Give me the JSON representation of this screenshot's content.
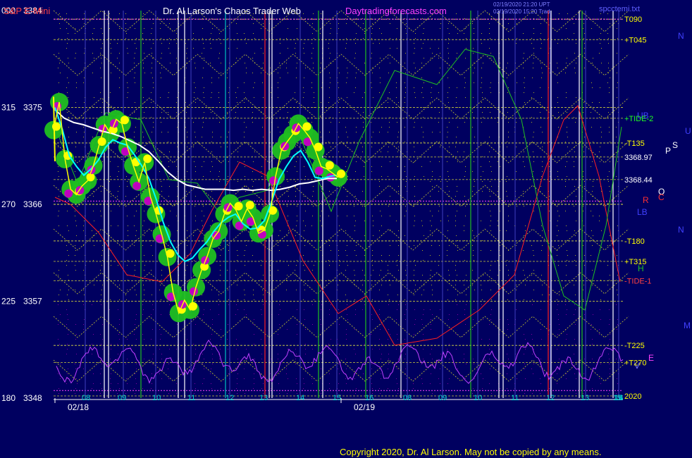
{
  "header": {
    "symbol": "S&P E-Mini",
    "title": "Dr. Al Larson's Chaos Trader Web",
    "site": "Daytradingforecasts.com",
    "stamp1": "02/19/2020 21:20 UPT",
    "stamp2": "02/19/2020 15:20 Trad",
    "file": "spcctemi.txt"
  },
  "copyright": "Copyright 2020, Dr. Al Larson. May not be copied by any means.",
  "colors": {
    "background": "#000060",
    "price": "#ffff00",
    "fast_avg": "#00ffff",
    "slow_avg": "#ffffff",
    "tide1": "#ff2020",
    "tide2": "#20c020",
    "oscillator": "#c040ff",
    "glow": "#20c020",
    "dots": "#ffff00",
    "dots_low": "#c000c0",
    "grid": "#ffff00"
  },
  "chart_data": {
    "type": "line",
    "title": "S&P E-Mini",
    "ylim": [
      3348,
      3384
    ],
    "y_ticks": [
      {
        "left": "000",
        "price": "3384"
      },
      {
        "left": "315",
        "price": "3375"
      },
      {
        "left": "270",
        "price": "3366"
      },
      {
        "left": "225",
        "price": "3357"
      },
      {
        "left": "180",
        "price": "3348"
      }
    ],
    "x_ticks": [
      "08",
      "09",
      "10",
      "11",
      "12",
      "13",
      "14",
      "15",
      "16",
      "08",
      "09",
      "10",
      "11",
      "12",
      "13",
      "14",
      "15",
      "16"
    ],
    "date_labels": [
      "02/18",
      "02/19"
    ],
    "legend_right": [
      {
        "label": "T090",
        "color": "#ffff00",
        "price": 3383.2
      },
      {
        "label": "+T045",
        "color": "#ffff00",
        "price": 3381.3
      },
      {
        "label": "+TIDE-2",
        "color": "#20ff20",
        "price": 3374.0
      },
      {
        "label": "-T135",
        "color": "#ffff00",
        "price": 3371.7
      },
      {
        "label": "3368.97",
        "color": "#ffffff",
        "price": 3370.4
      },
      {
        "label": "3368.44",
        "color": "#ffffff",
        "price": 3368.3
      },
      {
        "label": "-T180",
        "color": "#ffff00",
        "price": 3362.6
      },
      {
        "label": "+T315",
        "color": "#ffff00",
        "price": 3360.7
      },
      {
        "label": "-TIDE-1",
        "color": "#ff4040",
        "price": 3358.9
      },
      {
        "label": "-T225",
        "color": "#ffff00",
        "price": 3352.9
      },
      {
        "label": "+T270",
        "color": "#ffff00",
        "price": 3351.3
      },
      {
        "label": "2020",
        "color": "#ffff00",
        "price": 3348.2
      }
    ],
    "markers": [
      "N",
      "U",
      "P",
      "S",
      "O",
      "R",
      "C",
      "N",
      "H",
      "M",
      "UB",
      "LB",
      "E",
      "V"
    ],
    "series": [
      {
        "name": "Price",
        "values": [
          3372.9,
          3375.5,
          3370.2,
          3367.4,
          3366.9,
          3367.7,
          3368.2,
          3369.6,
          3371.5,
          3373.4,
          3372.6,
          3373.9,
          3373.5,
          3371.3,
          3369.6,
          3368.1,
          3369.9,
          3366.7,
          3365.1,
          3363.2,
          3361.1,
          3357.8,
          3355.9,
          3357.1,
          3356.2,
          3358.3,
          3359.9,
          3361.2,
          3362.8,
          3363.5,
          3365.1,
          3366.1,
          3365.5,
          3364.4,
          3365.6,
          3364.8,
          3363.3,
          3363.6,
          3365.1,
          3368.6,
          3371.0,
          3371.8,
          3372.5,
          3373.5,
          3372.9,
          3372.2,
          3371.0,
          3369.5,
          3369.3,
          3368.9,
          3368.5
        ]
      },
      {
        "name": "Fast Average",
        "values": [
          3375.0,
          3373.0,
          3370.5,
          3369.5,
          3368.7,
          3369.3,
          3370.1,
          3371.3,
          3372.0,
          3371.7,
          3371.5,
          3370.6,
          3369.6,
          3368.4,
          3366.5,
          3364.3,
          3362.5,
          3361.3,
          3360.7,
          3361.0,
          3361.8,
          3362.5,
          3363.5,
          3364.3,
          3364.8,
          3365.1,
          3364.2,
          3363.7,
          3363.8,
          3364.5,
          3366.3,
          3368.3,
          3369.5,
          3370.5,
          3371.0,
          3369.9,
          3368.5,
          3368.4,
          3368.6,
          3368.7
        ]
      },
      {
        "name": "Slow Average",
        "values": [
          3374.8,
          3374.0,
          3373.6,
          3373.4,
          3373.1,
          3372.8,
          3372.6,
          3372.3,
          3371.9,
          3371.5,
          3370.9,
          3370.0,
          3369.0,
          3368.3,
          3367.8,
          3367.6,
          3367.4,
          3367.4,
          3367.4,
          3367.3,
          3367.4,
          3367.3,
          3367.4,
          3367.3,
          3367.4,
          3367.6,
          3367.9,
          3368.0,
          3368.2,
          3368.4,
          3368.4
        ]
      }
    ]
  }
}
